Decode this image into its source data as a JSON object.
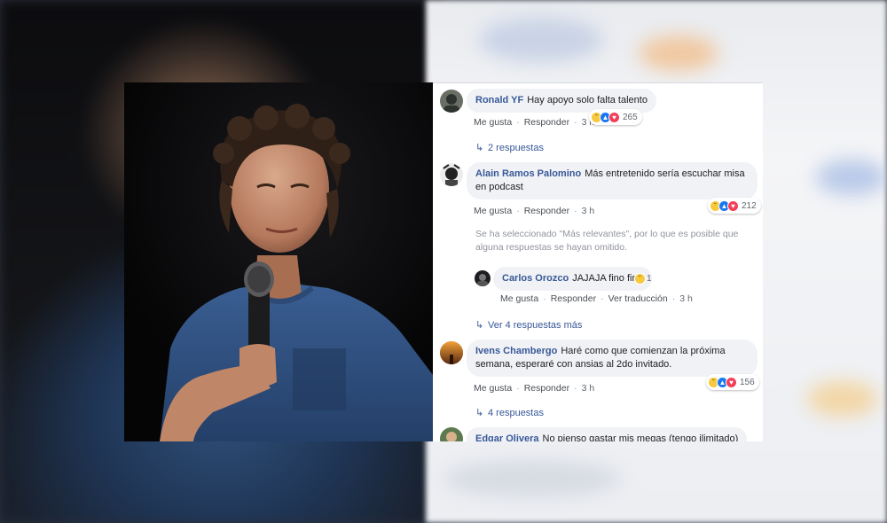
{
  "comments": [
    {
      "author": "Ronald YF",
      "text": "Hay apoyo solo falta talento",
      "like_label": "Me gusta",
      "reply_label": "Responder",
      "time": "3 h",
      "reaction_count": "265",
      "replies_label": "2 respuestas"
    },
    {
      "author": "Alain Ramos Palomino",
      "text": "Más entretenido sería escuchar misa en podcast",
      "like_label": "Me gusta",
      "reply_label": "Responder",
      "time": "3 h",
      "reaction_count": "212"
    },
    {
      "author": "Ivens Chambergo",
      "text": "Haré como que comienzan la próxima semana, esperaré con ansias al 2do invitado.",
      "like_label": "Me gusta",
      "reply_label": "Responder",
      "time": "3 h",
      "reaction_count": "156",
      "replies_label": "4 respuestas"
    },
    {
      "author": "Edgar Olivera",
      "text": "No pienso gastar mis megas (tengo ilimitado)"
    }
  ],
  "notice": "Se ha seleccionado \"Más relevantes\", por lo que es posible que alguna respuestas se hayan omitido.",
  "reply": {
    "author": "Carlos Orozco",
    "text": "JAJAJA fino fino",
    "reaction_count": "1",
    "like_label": "Me gusta",
    "reply_label": "Responder",
    "translate_label": "Ver traducción",
    "time": "3 h"
  },
  "more_replies_label": "Ver 4 respuestas más",
  "reaction_icons": [
    "haha-icon",
    "like-icon",
    "love-icon"
  ],
  "colors": {
    "link": "#385898",
    "bubble": "#f0f2f5",
    "like": "#1877f2",
    "love": "#f33e58",
    "haha": "#f7c93e"
  }
}
